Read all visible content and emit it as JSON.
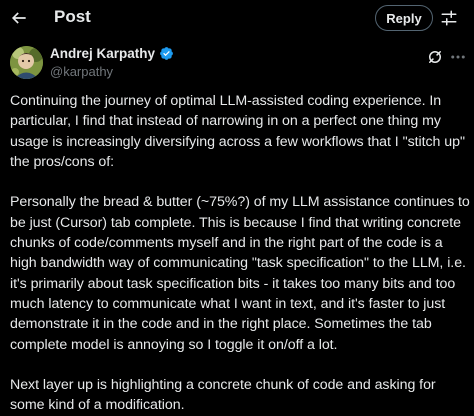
{
  "header": {
    "title": "Post",
    "reply_label": "Reply",
    "back_icon": "arrow-left-icon",
    "tune_icon": "sliders-icon"
  },
  "author": {
    "name": "Andrej Karpathy",
    "handle": "@karpathy",
    "verified_color": "#1d9bf0",
    "avatar_icon": "avatar"
  },
  "post": {
    "paragraphs": [
      "Continuing the journey of optimal LLM-assisted coding experience. In particular, I find that instead of narrowing in on a perfect one thing my usage is increasingly diversifying across a few workflows that I \"stitch up\" the pros/cons of:",
      "Personally the bread & butter (~75%?) of my LLM assistance continues to be just (Cursor) tab complete. This is because I find that writing concrete chunks of code/comments myself and in the right part of the code is a high bandwidth way of communicating \"task specification\" to the LLM, i.e. it's primarily about task specification bits - it takes too many bits and too much latency to communicate what I want in text, and it's faster to just demonstrate it in the code and in the right place. Sometimes the tab complete model is annoying so I toggle it on/off a lot.",
      "Next layer up is highlighting a concrete chunk of code and asking for some kind of a modification."
    ]
  },
  "colors": {
    "background": "#000000",
    "text_primary": "#e7e9ea",
    "text_secondary": "#71767b",
    "border": "#536471",
    "accent": "#1d9bf0"
  }
}
